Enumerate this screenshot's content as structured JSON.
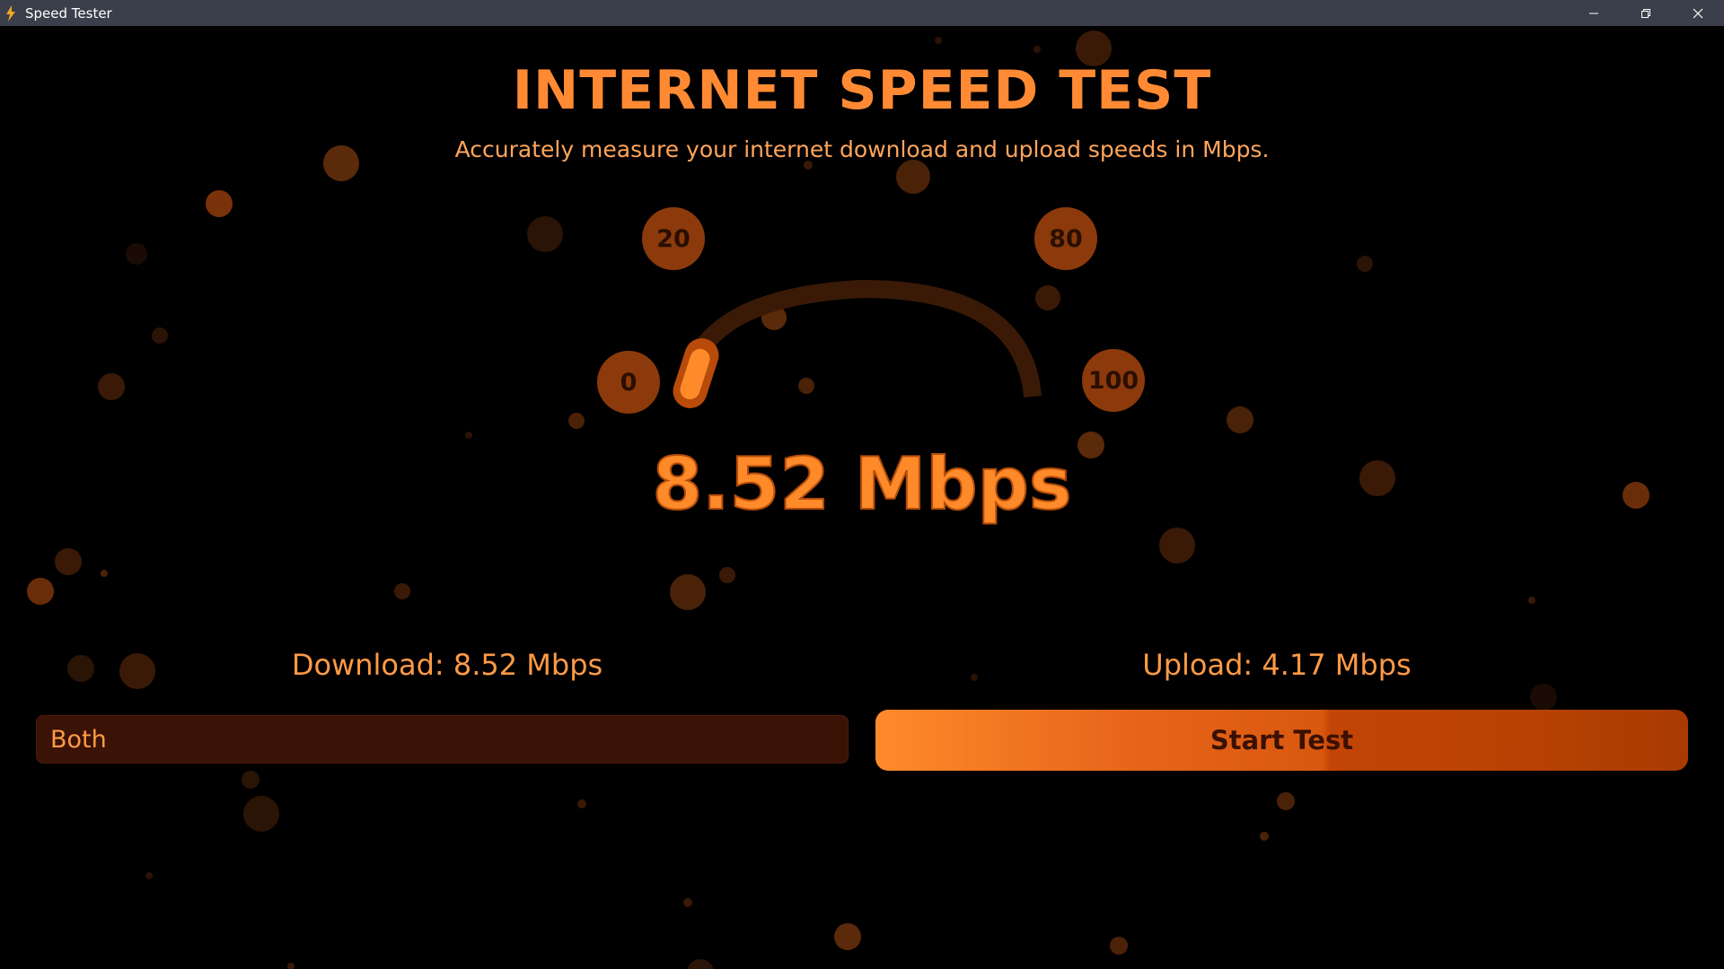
{
  "window": {
    "title": "Speed Tester"
  },
  "header": {
    "title": "INTERNET SPEED TEST",
    "subtitle": "Accurately measure your internet download and upload speeds in Mbps."
  },
  "gauge": {
    "min": 0,
    "max": 100,
    "ticks": [
      "0",
      "20",
      "80",
      "100"
    ],
    "current_value": 8.52,
    "current_display": "8.52 Mbps"
  },
  "results": {
    "download": "Download: 8.52 Mbps",
    "upload": "Upload: 4.17 Mbps"
  },
  "controls": {
    "mode_selected": "Both",
    "start_label": "Start Test"
  },
  "colors": {
    "accent": "#ff8a2a",
    "background": "#000000",
    "titlebar": "#3a3f4b"
  }
}
